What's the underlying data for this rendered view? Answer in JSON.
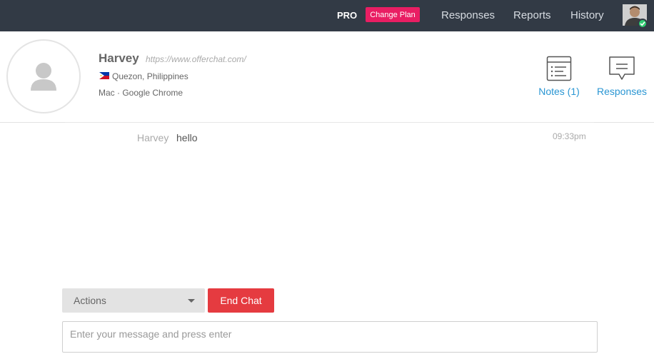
{
  "topbar": {
    "plan": "PRO",
    "change_plan_label": "Change Plan",
    "nav": {
      "responses": "Responses",
      "reports": "Reports",
      "history": "History"
    }
  },
  "visitor": {
    "name": "Harvey",
    "url": "https://www.offerchat.com/",
    "location": "Quezon, Philippines",
    "platform": "Mac · Google Chrome"
  },
  "tools": {
    "notes_label": "Notes (1)",
    "responses_label": "Responses"
  },
  "messages": [
    {
      "sender": "Harvey",
      "text": "hello",
      "time": "09:33pm"
    }
  ],
  "composer": {
    "actions_label": "Actions",
    "end_chat_label": "End Chat",
    "message_placeholder": "Enter your message and press enter"
  },
  "colors": {
    "topbar_bg": "#323a45",
    "change_plan": "#e91e63",
    "end_chat": "#e53b40",
    "link_blue": "#2a96d3",
    "online": "#2ecc71"
  },
  "icons": [
    "user-silhouette-icon",
    "philippines-flag-icon",
    "notes-list-icon",
    "responses-chat-icon",
    "chevron-down-icon",
    "online-check-icon"
  ]
}
